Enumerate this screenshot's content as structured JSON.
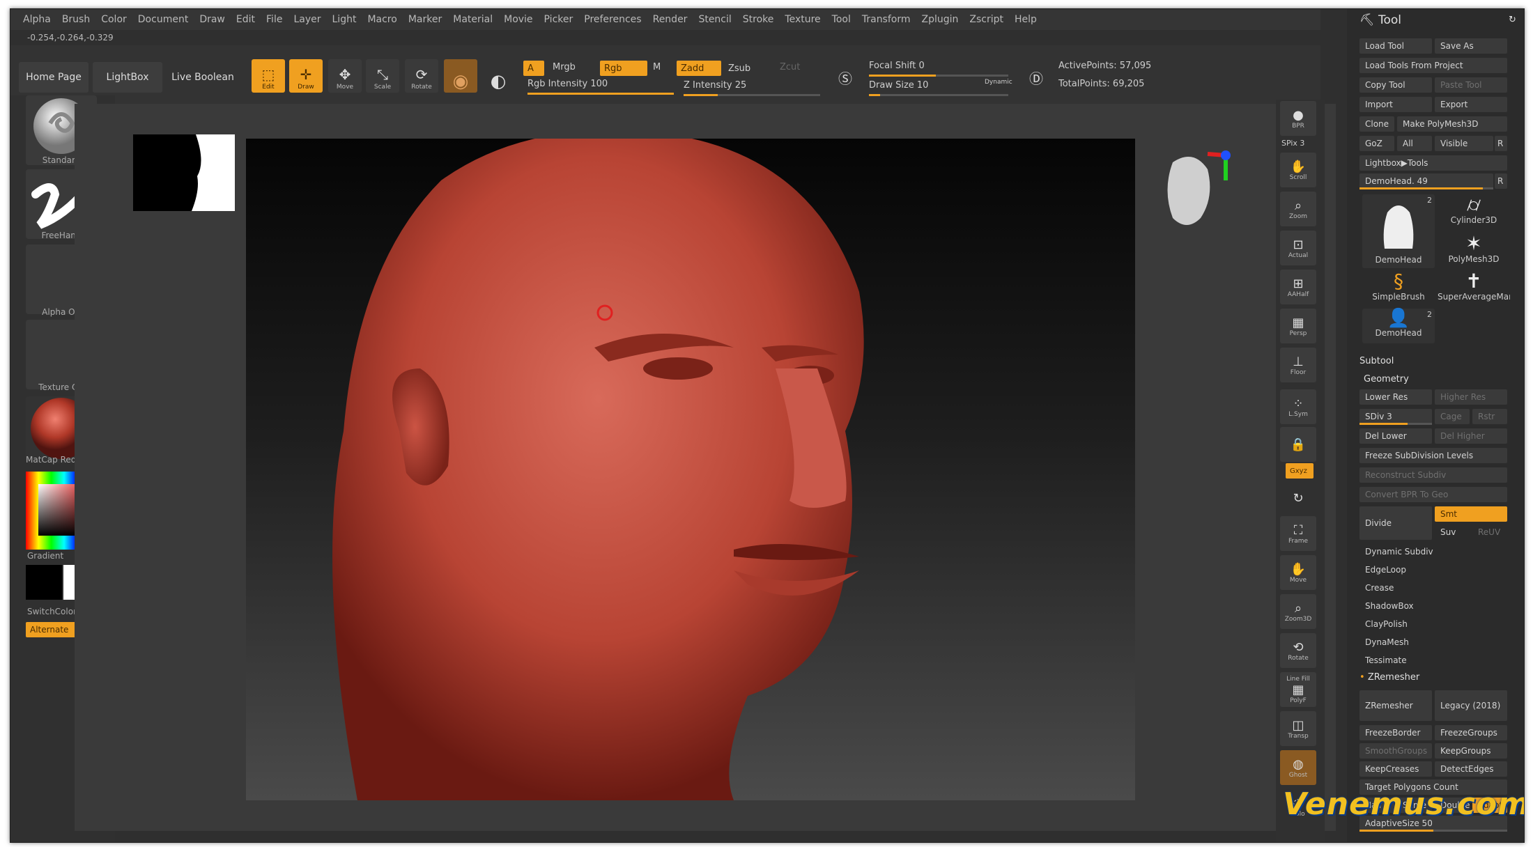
{
  "menu": [
    "Alpha",
    "Brush",
    "Color",
    "Document",
    "Draw",
    "Edit",
    "File",
    "Layer",
    "Light",
    "Macro",
    "Marker",
    "Material",
    "Movie",
    "Picker",
    "Preferences",
    "Render",
    "Stencil",
    "Stroke",
    "Texture",
    "Tool",
    "Transform",
    "Zplugin",
    "Zscript",
    "Help"
  ],
  "coords": "-0.254,-0.264,-0.329",
  "shelf": {
    "home_page": "Home Page",
    "lightbox": "LightBox",
    "live_boolean": "Live Boolean",
    "edit": "Edit",
    "draw": "Draw",
    "move": "Move",
    "scale": "Scale",
    "rotate": "Rotate",
    "a_label": "A",
    "mrgb": "Mrgb",
    "rgb": "Rgb",
    "m": "M",
    "zadd": "Zadd",
    "zsub": "Zsub",
    "zcut": "Zcut",
    "rgb_intensity": "Rgb Intensity 100",
    "rgb_intensity_value": 100,
    "z_intensity": "Z Intensity 25",
    "z_intensity_value": 25,
    "focal_shift": "Focal Shift 0",
    "draw_size": "Draw Size 10",
    "dynamic": "Dynamic",
    "active_points": "ActivePoints: 57,095",
    "total_points": "TotalPoints: 69,205"
  },
  "left_panel": {
    "brush": "Standard",
    "stroke": "FreeHand",
    "alpha": "Alpha Off",
    "texture": "Texture Off",
    "material": "MatCap Red Wax",
    "gradient": "Gradient",
    "switch_color": "SwitchColor",
    "alternate": "Alternate"
  },
  "right_shelf": {
    "bpr": "BPR",
    "spix": "SPix 3",
    "scroll": "Scroll",
    "zoom": "Zoom",
    "actual": "Actual",
    "aahalf": "AAHalf",
    "persp": "Persp",
    "dynamic": "Dynamic",
    "floor": "Floor",
    "lsym": "L.Sym",
    "gxyz": "Gxyz",
    "frame": "Frame",
    "move": "Move",
    "zoom3d": "Zoom3D",
    "rotate": "Rotate",
    "linefill": "Line Fill",
    "polyf": "PolyF",
    "transp": "Transp",
    "ghost": "Ghost",
    "solo": "Solo"
  },
  "tool_panel": {
    "title": "Tool",
    "load_tool": "Load Tool",
    "save_as": "Save As",
    "load_from_project": "Load Tools From Project",
    "copy_tool": "Copy Tool",
    "paste_tool": "Paste Tool",
    "import": "Import",
    "export": "Export",
    "clone": "Clone",
    "make_polymesh": "Make PolyMesh3D",
    "goz": "GoZ",
    "all": "All",
    "visible": "Visible",
    "r": "R",
    "lightbox_tools": "Lightbox▶Tools",
    "demohead_slider": "DemoHead. 49",
    "demohead_value": 49,
    "thumbs": [
      {
        "label": "DemoHead",
        "badge": "2"
      },
      {
        "label": "Cylinder3D",
        "badge": ""
      },
      {
        "label": "PolyMesh3D",
        "badge": ""
      },
      {
        "label": "SimpleBrush",
        "badge": ""
      },
      {
        "label": "SuperAverageMan",
        "badge": ""
      },
      {
        "label": "DemoHead",
        "badge": "2"
      }
    ],
    "subtool": "Subtool",
    "geometry": "Geometry",
    "lower_res": "Lower Res",
    "higher_res": "Higher Res",
    "sdiv": "SDiv 3",
    "cage": "Cage",
    "rstr": "Rstr",
    "del_lower": "Del Lower",
    "del_higher": "Del Higher",
    "freeze_subdiv": "Freeze SubDivision Levels",
    "reconstruct_subdiv": "Reconstruct Subdiv",
    "convert_bpr": "Convert BPR To Geo",
    "divide": "Divide",
    "smt": "Smt",
    "suv": "Suv",
    "reuv": "ReUV",
    "dynamic_subdiv": "Dynamic Subdiv",
    "edgeloop": "EdgeLoop",
    "crease": "Crease",
    "shadowbox": "ShadowBox",
    "claypolish": "ClayPolish",
    "dynamesh": "DynaMesh",
    "tessimate": "Tessimate",
    "zremesher_section": "ZRemesher",
    "zremesher_btn": "ZRemesher",
    "legacy": "Legacy (2018)",
    "freezeborder": "FreezeBorder",
    "freezegroups": "FreezeGroups",
    "smoothgroups": "SmoothGroups",
    "keepgroups": "KeepGroups",
    "keepcreases": "KeepCreases",
    "detectedges": "DetectEdges",
    "target_polygons": "Target Polygons Count",
    "half": "Half",
    "same": "Same",
    "double": "Double",
    "adapt": "Adapt",
    "adaptive_size": "AdaptiveSize 50"
  },
  "watermark": "Venemus.com",
  "colors": {
    "accent": "#f0a020",
    "panel": "#2b2b2b",
    "skin": "#c0493a"
  }
}
